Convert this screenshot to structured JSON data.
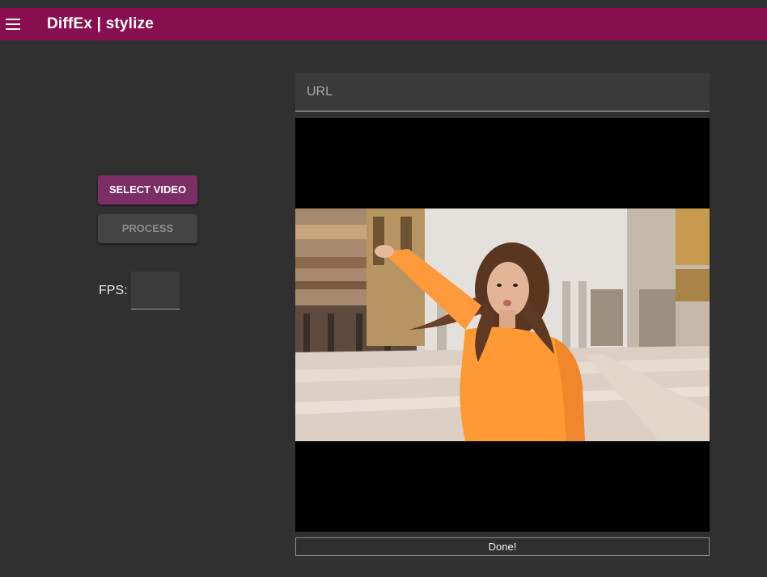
{
  "app": {
    "title": "DiffEx | stylize"
  },
  "toolbar": {
    "menu_icon": "menu-icon"
  },
  "controls": {
    "select_video_label": "SELECT VIDEO",
    "process_label": "PROCESS",
    "fps_label": "FPS:",
    "fps_value": ""
  },
  "url": {
    "placeholder": "URL",
    "value": ""
  },
  "video": {
    "content": "frame of woman in orange top in front of building"
  },
  "status": {
    "text": "Done!"
  },
  "colors": {
    "appbar": "#880e4f",
    "primary_button": "#7b2d66",
    "background": "#303030"
  }
}
